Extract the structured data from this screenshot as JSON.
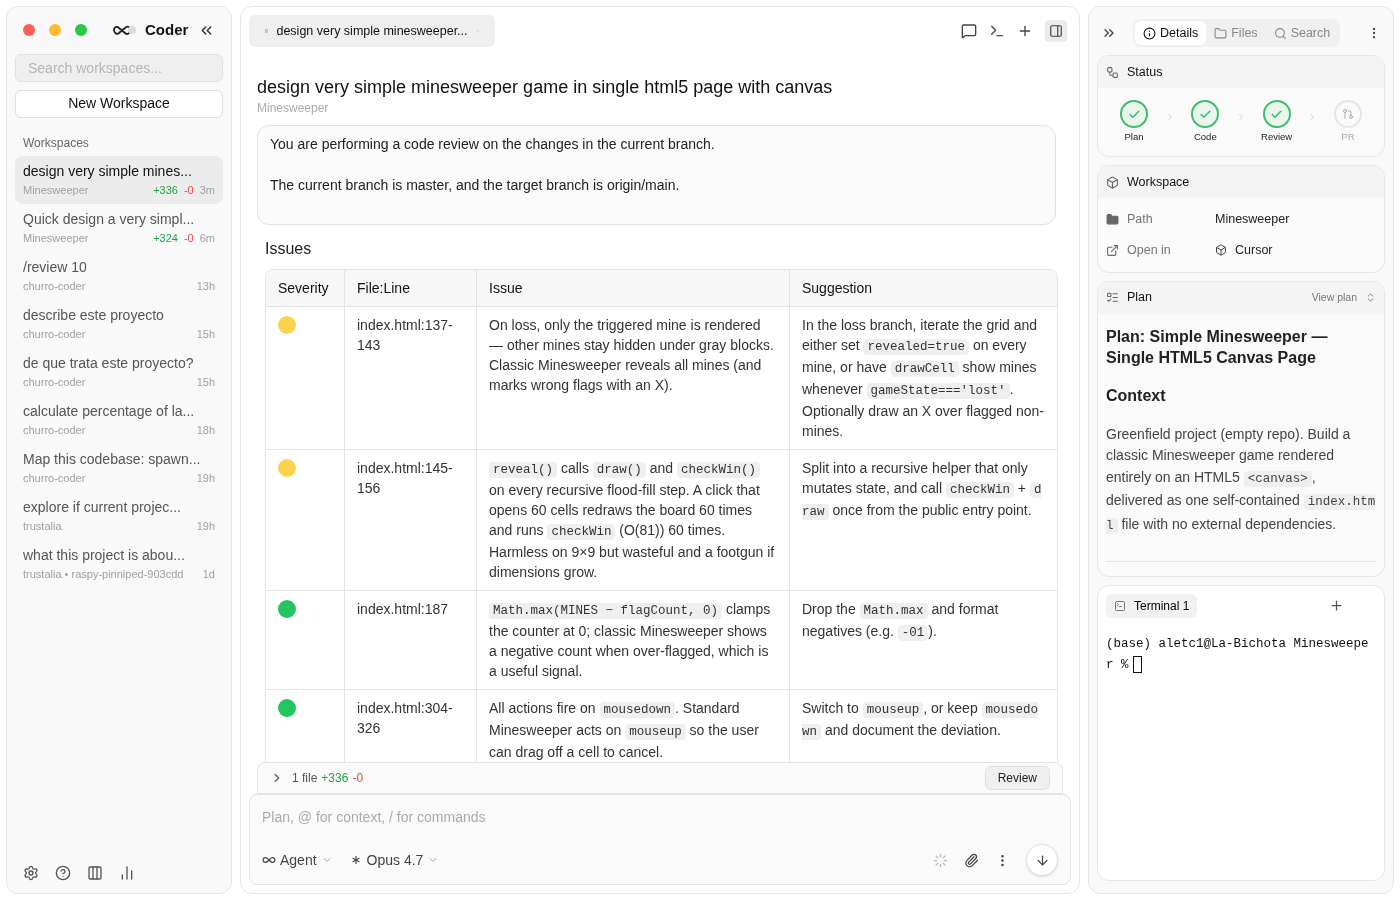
{
  "app": {
    "name": "Coder"
  },
  "sidebar": {
    "search": {
      "placeholder": "Search workspaces..."
    },
    "new_button": "New Workspace",
    "section": "Workspaces",
    "items": [
      {
        "title": "design very simple mines...",
        "project": "Minesweeper",
        "added": "+336",
        "removed": "-0",
        "time": "3m",
        "selected": true
      },
      {
        "title": "Quick design a very simpl...",
        "project": "Minesweeper",
        "added": "+324",
        "removed": "-0",
        "time": "6m",
        "selected": false
      },
      {
        "title": "/review 10",
        "project": "churro-coder",
        "time": "13h",
        "selected": false
      },
      {
        "title": "describe este proyecto",
        "project": "churro-coder",
        "time": "15h",
        "selected": false
      },
      {
        "title": "de que trata este proyecto?",
        "project": "churro-coder",
        "time": "15h",
        "selected": false
      },
      {
        "title": "calculate percentage of la...",
        "project": "churro-coder",
        "time": "18h",
        "selected": false
      },
      {
        "title": "Map this codebase: spawn...",
        "project": "churro-coder",
        "time": "19h",
        "selected": false
      },
      {
        "title": "explore if current projec...",
        "project": "trustalia",
        "time": "19h",
        "selected": false
      },
      {
        "title": "what this project is abou...",
        "project": "trustalia • raspy-pinniped-903cdd",
        "time": "1d",
        "selected": false
      }
    ]
  },
  "main": {
    "tab": {
      "label": "design very simple minesweeper...",
      "selected": true
    },
    "title": "design very simple minesweeper game in single html5 page with canvas",
    "project": "Minesweeper",
    "prompt": [
      "You are performing a code review on the changes in the current branch.",
      "The current branch is master, and the target branch is origin/main."
    ],
    "issues_heading": "Issues",
    "table": {
      "columns": [
        "Severity",
        "File:Line",
        "Issue",
        "Suggestion"
      ],
      "rows": [
        {
          "color": "#fcd34d",
          "file": "index.html:137-143",
          "issue": [
            {
              "kind": "text",
              "text": "On loss, only the triggered mine is rendered — other mines stay hidden under gray blocks. Classic Minesweeper reveals all mines (and marks wrong flags with an X)."
            }
          ],
          "suggestion": [
            {
              "kind": "text",
              "text": "In the loss branch, iterate the grid and either set "
            },
            {
              "kind": "code",
              "text": "revealed=true"
            },
            {
              "kind": "text",
              "text": " on every mine, or have "
            },
            {
              "kind": "code",
              "text": "drawCell"
            },
            {
              "kind": "text",
              "text": " show mines whenever "
            },
            {
              "kind": "code",
              "text": "gameState==='lost'"
            },
            {
              "kind": "text",
              "text": ". Optionally draw an X over flagged non-mines."
            }
          ]
        },
        {
          "color": "#fcd34d",
          "file": "index.html:145-156",
          "issue": [
            {
              "kind": "code",
              "text": "reveal()"
            },
            {
              "kind": "text",
              "text": " calls "
            },
            {
              "kind": "code",
              "text": "draw()"
            },
            {
              "kind": "text",
              "text": " and "
            },
            {
              "kind": "code",
              "text": "checkWin()"
            },
            {
              "kind": "text",
              "text": " on every recursive flood-fill step. A click that opens 60 cells redraws the board 60 times and runs "
            },
            {
              "kind": "code",
              "text": "checkWin"
            },
            {
              "kind": "text",
              "text": " (O(81)) 60 times. Harmless on 9×9 but wasteful and a footgun if dimensions grow."
            }
          ],
          "suggestion": [
            {
              "kind": "text",
              "text": "Split into a recursive helper that only mutates state, and call "
            },
            {
              "kind": "code",
              "text": "checkWin"
            },
            {
              "kind": "text",
              "text": " + "
            },
            {
              "kind": "code",
              "text": "draw"
            },
            {
              "kind": "text",
              "text": " once from the public entry point."
            }
          ]
        },
        {
          "color": "#22c55e",
          "file": "index.html:187",
          "issue": [
            {
              "kind": "code",
              "text": "Math.max(MINES − flagCount, 0)"
            },
            {
              "kind": "text",
              "text": " clamps the counter at 0; classic Minesweeper shows a negative count when over-flagged, which is a useful signal."
            }
          ],
          "suggestion": [
            {
              "kind": "text",
              "text": "Drop the "
            },
            {
              "kind": "code",
              "text": "Math.max"
            },
            {
              "kind": "text",
              "text": " and format negatives (e.g. "
            },
            {
              "kind": "code",
              "text": "-01"
            },
            {
              "kind": "text",
              "text": ")."
            }
          ]
        },
        {
          "color": "#22c55e",
          "file": "index.html:304-326",
          "issue": [
            {
              "kind": "text",
              "text": "All actions fire on "
            },
            {
              "kind": "code",
              "text": "mousedown"
            },
            {
              "kind": "text",
              "text": ". Standard Minesweeper acts on "
            },
            {
              "kind": "code",
              "text": "mouseup"
            },
            {
              "kind": "text",
              "text": " so the user can drag off a cell to cancel."
            }
          ],
          "suggestion": [
            {
              "kind": "text",
              "text": "Switch to "
            },
            {
              "kind": "code",
              "text": "mouseup"
            },
            {
              "kind": "text",
              "text": ", or keep "
            },
            {
              "kind": "code",
              "text": "mousedown"
            },
            {
              "kind": "text",
              "text": " and document the deviation."
            }
          ]
        }
      ]
    },
    "changes": {
      "files": "1 file",
      "added": "+336",
      "removed": "-0",
      "button": "Review"
    },
    "composer": {
      "placeholder": "Plan, @ for context, / for commands",
      "mode": "Agent",
      "model": "Opus 4.7"
    }
  },
  "panel": {
    "tabs": [
      {
        "label": "Details",
        "selected": true
      },
      {
        "label": "Files",
        "selected": false
      },
      {
        "label": "Search",
        "selected": false
      }
    ],
    "status": {
      "title": "Status",
      "steps": [
        {
          "label": "Plan",
          "done": true
        },
        {
          "label": "Code",
          "done": true
        },
        {
          "label": "Review",
          "done": true
        },
        {
          "label": "PR",
          "done": false
        }
      ]
    },
    "workspace": {
      "title": "Workspace",
      "rows": [
        {
          "label": "Path",
          "value": "Minesweeper"
        },
        {
          "label": "Open in",
          "value": "Cursor"
        }
      ]
    },
    "plan": {
      "title": "Plan",
      "view": "View plan",
      "heading": "Plan: Simple Minesweeper — Single HTML5 Canvas Page",
      "subheading": "Context",
      "body": [
        {
          "kind": "text",
          "text": "Greenfield project (empty repo). Build a classic Minesweeper game rendered entirely on an HTML5 "
        },
        {
          "kind": "code",
          "text": "<canvas>"
        },
        {
          "kind": "text",
          "text": ", delivered as one self-contained "
        },
        {
          "kind": "code",
          "text": "index.html"
        },
        {
          "kind": "text",
          "text": " file with no external dependencies."
        }
      ]
    },
    "terminal": {
      "tab": "Terminal 1",
      "output": "(base) aletc1@La-Bichota Minesweeper %"
    }
  }
}
